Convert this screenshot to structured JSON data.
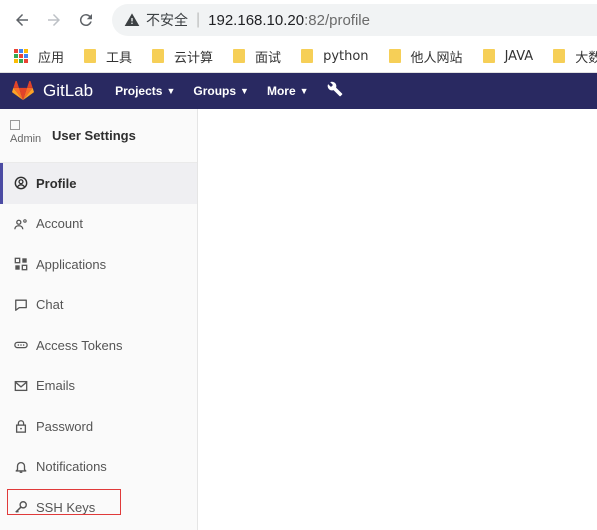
{
  "browser": {
    "insecure_label": "不安全",
    "url_host": "192.168.10.20",
    "url_path": ":82/profile"
  },
  "bookmarks": {
    "apps": "应用",
    "items": [
      "工具",
      "云计算",
      "面试",
      "python",
      "他人网站",
      "JAVA",
      "大数据"
    ]
  },
  "gitlab": {
    "brand": "GitLab",
    "nav": {
      "projects": "Projects",
      "groups": "Groups",
      "more": "More"
    }
  },
  "sidebar": {
    "avatar_alt": "Admin",
    "title": "User Settings",
    "items": [
      {
        "label": "Profile",
        "icon": "profile-icon",
        "active": true
      },
      {
        "label": "Account",
        "icon": "account-icon"
      },
      {
        "label": "Applications",
        "icon": "applications-icon"
      },
      {
        "label": "Chat",
        "icon": "chat-icon"
      },
      {
        "label": "Access Tokens",
        "icon": "access-tokens-icon"
      },
      {
        "label": "Emails",
        "icon": "emails-icon"
      },
      {
        "label": "Password",
        "icon": "password-icon"
      },
      {
        "label": "Notifications",
        "icon": "notifications-icon"
      },
      {
        "label": "SSH Keys",
        "icon": "ssh-keys-icon"
      }
    ]
  },
  "colors": {
    "header_bg": "#292961",
    "active_indicator": "#4b4ba3",
    "highlight_box": "#e03a3a"
  }
}
